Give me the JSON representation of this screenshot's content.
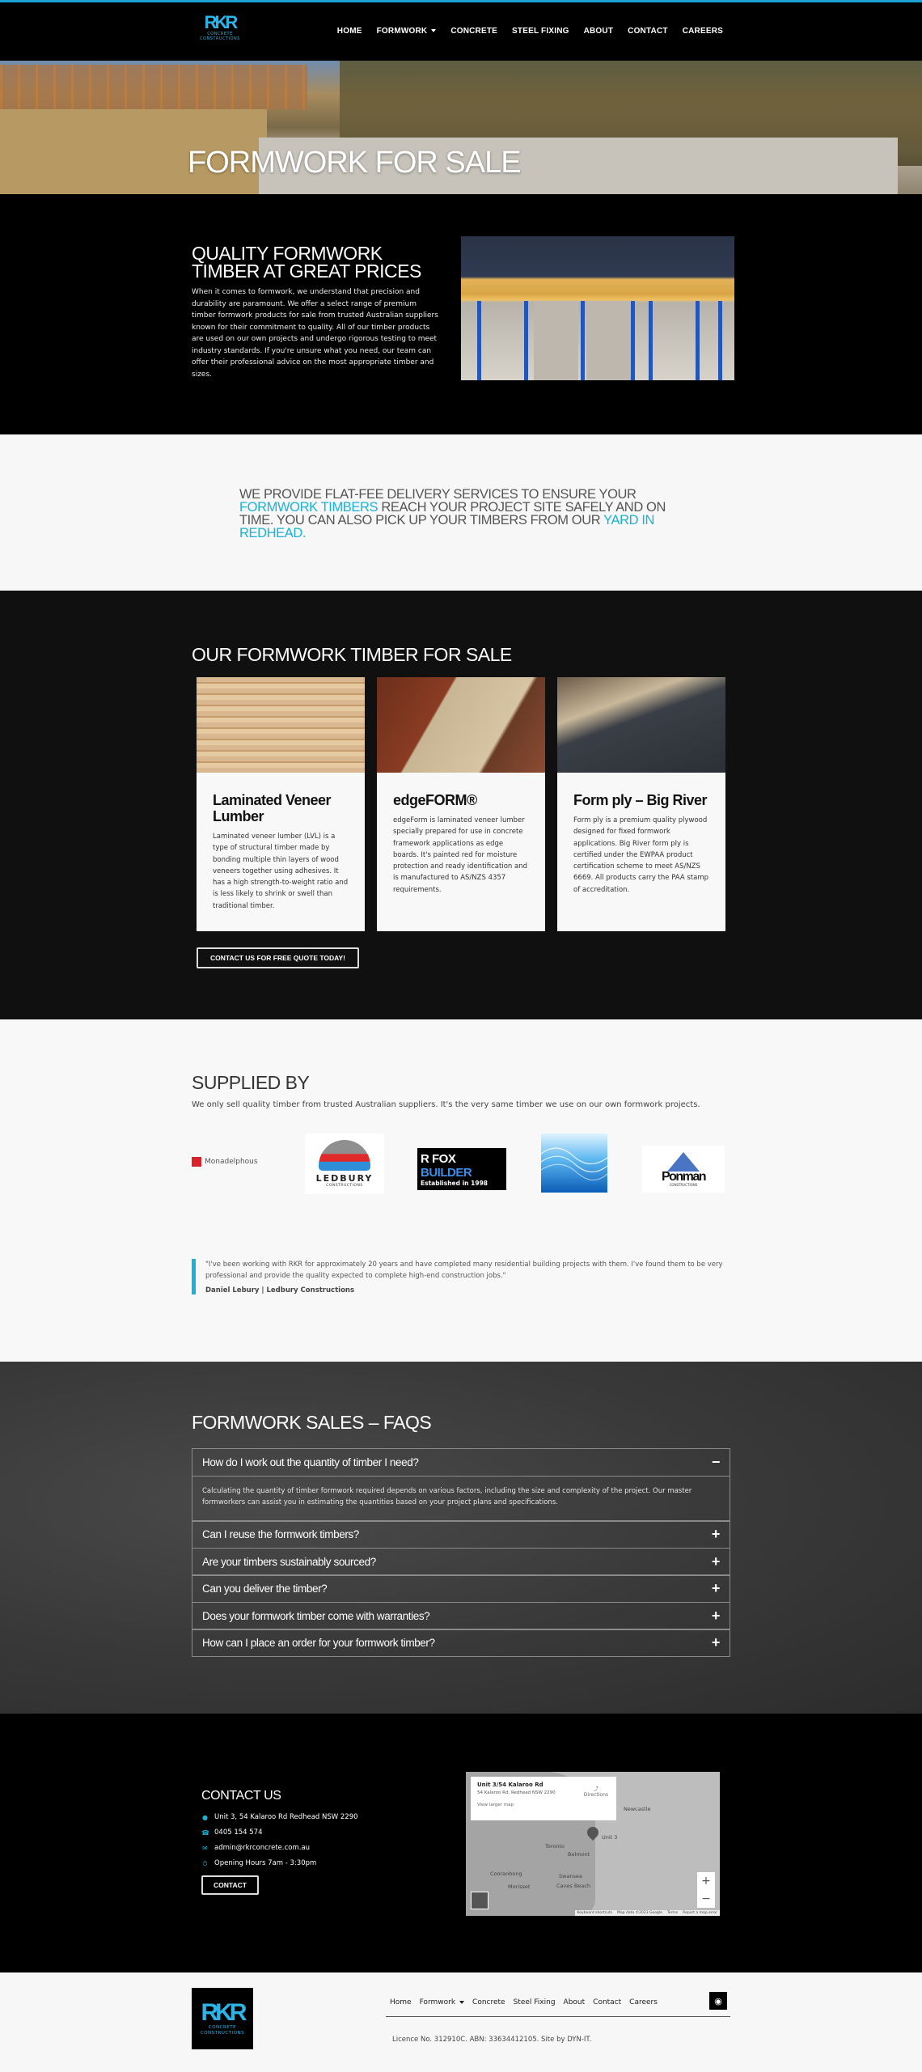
{
  "brand": {
    "logo_mark": "RKR",
    "logo_line1": "CONCRETE",
    "logo_line2": "CONSTRUCTIONS",
    "accent_color": "#1ab2d8"
  },
  "nav": {
    "items": [
      {
        "label": "HOME"
      },
      {
        "label": "FORMWORK",
        "has_dropdown": true
      },
      {
        "label": "CONCRETE"
      },
      {
        "label": "STEEL FIXING"
      },
      {
        "label": "ABOUT"
      },
      {
        "label": "CONTACT"
      },
      {
        "label": "CAREERS"
      }
    ]
  },
  "hero": {
    "title": "FORMWORK FOR SALE"
  },
  "quality": {
    "heading": "QUALITY FORMWORK TIMBER AT GREAT PRICES",
    "body": "When it comes to formwork, we understand that precision and durability are paramount. We offer a select range of premium timber formwork products for sale from trusted Australian suppliers known for their commitment to quality. All of our timber products are used on our own projects and undergo rigorous testing to meet industry standards. If you're unsure what you need, our team can offer their professional advice on the most appropriate timber and sizes."
  },
  "delivery": {
    "part1": "WE PROVIDE FLAT-FEE DELIVERY SERVICES TO ENSURE YOUR ",
    "link1": "FORMWORK TIMBERS",
    "part2": " REACH YOUR PROJECT SITE SAFELY AND ON TIME. YOU CAN ALSO PICK UP YOUR TIMBERS FROM OUR ",
    "link2": "YARD IN REDHEAD."
  },
  "products": {
    "heading": "OUR FORMWORK TIMBER FOR SALE",
    "cards": [
      {
        "title": "Laminated Veneer Lumber",
        "body": "Laminated veneer lumber (LVL) is a type of structural timber made by bonding multiple thin layers of wood veneers together using adhesives. It has a high strength-to-weight ratio and is less likely to shrink or swell than traditional timber."
      },
      {
        "title": "edgeFORM®",
        "body": "edgeForm is laminated veneer lumber specially prepared for use in concrete framework applications as edge boards. It's painted red for moisture protection and ready identification and is manufactured to AS/NZS 4357 requirements."
      },
      {
        "title": "Form ply – Big River",
        "body": "Form ply is a premium quality plywood designed for fixed formwork applications. Big River form ply is certified under the EWPAA product certification scheme to meet AS/NZS 6669. All products carry the PAA stamp of accreditation."
      }
    ],
    "cta_label": "CONTACT US FOR FREE QUOTE TODAY!"
  },
  "supplied": {
    "heading": "SUPPLIED BY",
    "intro": "We only sell quality timber from trusted Australian suppliers. It's the very same timber we use on our own formwork projects.",
    "logos": {
      "monadelphous": "Monadelphous",
      "ledbury": "LEDBURY",
      "ledbury_sub": "CONSTRUCTIONS",
      "rfox_a": "R FOX ",
      "rfox_b": "BUILDER",
      "rfox_sub": "Established in 1998",
      "ponman": "Ponman",
      "ponman_sub": "CONSTRUCTIONS"
    },
    "testimonial": {
      "quote": "\"I've been working with RKR for approximately 20 years and have completed many residential building projects with them. I've found them to be very professional and provide the quality expected to complete high-end construction jobs.\"",
      "author": "Daniel Lebury | Ledbury Constructions"
    }
  },
  "faq": {
    "heading": "FORMWORK SALES – FAQS",
    "items": [
      {
        "question": "How do I work out the quantity of timber I need?",
        "expanded": true,
        "icon": "−",
        "answer": "Calculating the quantity of timber formwork required depends on various factors, including the size and complexity of the project. Our master formworkers can assist you in estimating the quantities based on your project plans and specifications."
      },
      {
        "question": "Can I reuse the formwork timbers?",
        "expanded": false,
        "icon": "+"
      },
      {
        "question": "Are your timbers sustainably sourced?",
        "expanded": false,
        "icon": "+"
      },
      {
        "question": "Can you deliver the timber?",
        "expanded": false,
        "icon": "+"
      },
      {
        "question": "Does your formwork timber come with warranties?",
        "expanded": false,
        "icon": "+"
      },
      {
        "question": "How can I place an order for your formwork timber?",
        "expanded": false,
        "icon": "+"
      }
    ]
  },
  "contact": {
    "heading": "CONTACT US",
    "address": "Unit 3, 54 Kalaroo Rd Redhead NSW 2290",
    "phone": "0405 154 574",
    "email": "admin@rkrconcrete.com.au",
    "hours": "Opening Hours 7am - 3:30pm",
    "button_label": "CONTACT",
    "map": {
      "place_title": "Unit 3/54 Kalaroo Rd",
      "place_address": "54 Kalaroo Rd, Redhead NSW 2290",
      "view_larger": "View larger map",
      "directions": "Directions",
      "pin_label": "Unit 3",
      "places": [
        "Newcastle",
        "Toronto",
        "Belmont",
        "Cooranbong",
        "Swansea",
        "Caves Beach",
        "Morisset"
      ],
      "footer": [
        "Keyboard shortcuts",
        "Map data ©2023 Google",
        "Terms",
        "Report a map error"
      ]
    }
  },
  "footer": {
    "nav": [
      {
        "label": "Home"
      },
      {
        "label": "Formwork",
        "has_dropdown": true
      },
      {
        "label": "Concrete"
      },
      {
        "label": "Steel Fixing"
      },
      {
        "label": "About"
      },
      {
        "label": "Contact"
      },
      {
        "label": "Careers"
      }
    ],
    "social_icon": "instagram-icon",
    "legal": "Licence No. 312910C. ABN:  33634412105. Site by DYN-IT."
  }
}
